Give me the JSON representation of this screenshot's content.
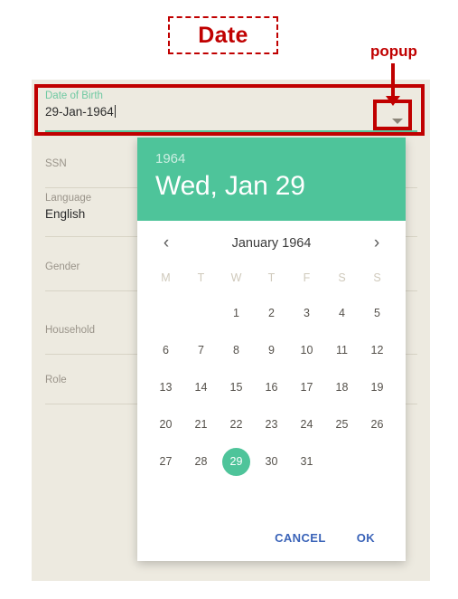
{
  "annotations": {
    "title_label": "Date",
    "popup_label": "popup"
  },
  "form": {
    "fields": [
      {
        "label": "Date of Birth",
        "value": "29-Jan-1964"
      },
      {
        "label": "SSN",
        "value": ""
      },
      {
        "label": "Language",
        "value": "English"
      },
      {
        "label": "Gender",
        "value": ""
      },
      {
        "label": "Household",
        "value": ""
      },
      {
        "label": "Role",
        "value": ""
      }
    ]
  },
  "datepicker": {
    "header_year": "1964",
    "header_date": "Wed, Jan 29",
    "prev_icon": "‹",
    "next_icon": "›",
    "month_title": "January 1964",
    "weekdays": [
      "M",
      "T",
      "W",
      "T",
      "F",
      "S",
      "S"
    ],
    "leading_blanks": 2,
    "days": [
      1,
      2,
      3,
      4,
      5,
      6,
      7,
      8,
      9,
      10,
      11,
      12,
      13,
      14,
      15,
      16,
      17,
      18,
      19,
      20,
      21,
      22,
      23,
      24,
      25,
      26,
      27,
      28,
      29,
      30,
      31
    ],
    "selected_day": 29,
    "cancel_label": "CANCEL",
    "ok_label": "OK"
  },
  "colors": {
    "accent_green": "#4ec49a",
    "panel_bg": "#edeae0",
    "annotation_red": "#c00000",
    "action_blue": "#3a63b8"
  }
}
